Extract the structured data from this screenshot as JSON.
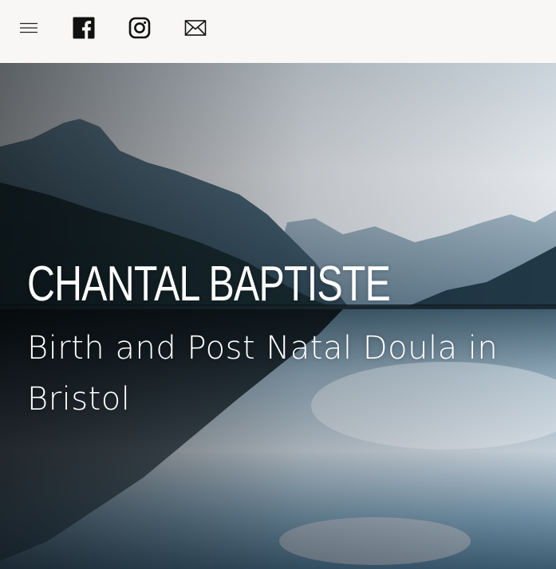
{
  "header": {
    "icons": [
      "hamburger-menu-icon",
      "facebook-icon",
      "instagram-icon",
      "mail-icon"
    ]
  },
  "hero": {
    "title": "CHANTAL BAPTISTE",
    "subtitle": "Birth and Post Natal Doula in Bristol"
  },
  "colors": {
    "header_bg": "#f8f7f5",
    "icon_color": "#111111",
    "hero_text": "#ffffff",
    "sky": "#dfe4ea",
    "water": "#6d8fa5",
    "mountain": "#2b4a5c"
  }
}
